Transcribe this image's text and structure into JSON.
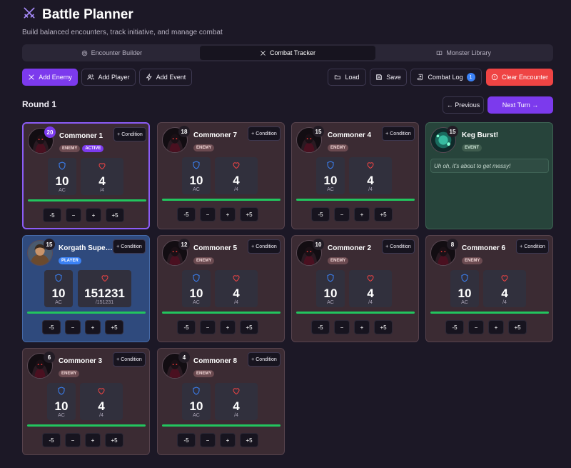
{
  "app": {
    "title": "Battle Planner",
    "subtitle": "Build balanced encounters, track initiative, and manage combat"
  },
  "tabs": [
    {
      "label": "Encounter Builder",
      "icon": "target-icon"
    },
    {
      "label": "Combat Tracker",
      "icon": "crossed-swords-icon",
      "active": true
    },
    {
      "label": "Monster Library",
      "icon": "book-icon"
    }
  ],
  "toolbar": {
    "add_enemy": "Add Enemy",
    "add_player": "Add Player",
    "add_event": "Add Event",
    "load": "Load",
    "save": "Save",
    "combat_log": "Combat Log",
    "combat_log_count": "1",
    "clear": "Clear Encounter"
  },
  "round": {
    "label": "Round 1",
    "previous": "← Previous",
    "next": "Next Turn →"
  },
  "controls": {
    "minus5": "-5",
    "minus": "−",
    "plus": "+",
    "plus5": "+5",
    "condition": "Condition"
  },
  "cards": [
    {
      "name": "Commoner 1",
      "initiative": "20",
      "type": "enemy",
      "tags": [
        "ENEMY",
        "ACTIVE"
      ],
      "ac": "10",
      "ac_label": "AC",
      "hp": "4",
      "hp_max": "/4",
      "hp_fraction": 1.0,
      "active": true
    },
    {
      "name": "Commoner 7",
      "initiative": "18",
      "type": "enemy",
      "tags": [
        "ENEMY"
      ],
      "ac": "10",
      "ac_label": "AC",
      "hp": "4",
      "hp_max": "/4",
      "hp_fraction": 1.0
    },
    {
      "name": "Commoner 4",
      "initiative": "15",
      "type": "enemy",
      "tags": [
        "ENEMY"
      ],
      "ac": "10",
      "ac_label": "AC",
      "hp": "4",
      "hp_max": "/4",
      "hp_fraction": 1.0
    },
    {
      "name": "Keg Burst!",
      "initiative": "15",
      "type": "event",
      "tags": [
        "EVENT"
      ],
      "description": "Uh oh, it's about to get messy!"
    },
    {
      "name": "Korgath Super...",
      "initiative": "15",
      "type": "player",
      "tags": [
        "PLAYER"
      ],
      "ac": "10",
      "ac_label": "AC",
      "hp": "151231",
      "hp_max": "/151231",
      "hp_fraction": 1.0
    },
    {
      "name": "Commoner 5",
      "initiative": "12",
      "type": "enemy",
      "tags": [
        "ENEMY"
      ],
      "ac": "10",
      "ac_label": "AC",
      "hp": "4",
      "hp_max": "/4",
      "hp_fraction": 1.0
    },
    {
      "name": "Commoner 2",
      "initiative": "10",
      "type": "enemy",
      "tags": [
        "ENEMY"
      ],
      "ac": "10",
      "ac_label": "AC",
      "hp": "4",
      "hp_max": "/4",
      "hp_fraction": 1.0
    },
    {
      "name": "Commoner 6",
      "initiative": "8",
      "type": "enemy",
      "tags": [
        "ENEMY"
      ],
      "ac": "10",
      "ac_label": "AC",
      "hp": "4",
      "hp_max": "/4",
      "hp_fraction": 1.0
    },
    {
      "name": "Commoner 3",
      "initiative": "6",
      "type": "enemy",
      "tags": [
        "ENEMY"
      ],
      "ac": "10",
      "ac_label": "AC",
      "hp": "4",
      "hp_max": "/4",
      "hp_fraction": 1.0
    },
    {
      "name": "Commoner 8",
      "initiative": "4",
      "type": "enemy",
      "tags": [
        "ENEMY"
      ],
      "ac": "10",
      "ac_label": "AC",
      "hp": "4",
      "hp_max": "/4",
      "hp_fraction": 1.0
    }
  ],
  "colors": {
    "accent": "#7c3aed",
    "danger": "#ef4444",
    "hp_bar": "#22c55e",
    "shield": "#3b82f6",
    "heart": "#ef4444"
  }
}
